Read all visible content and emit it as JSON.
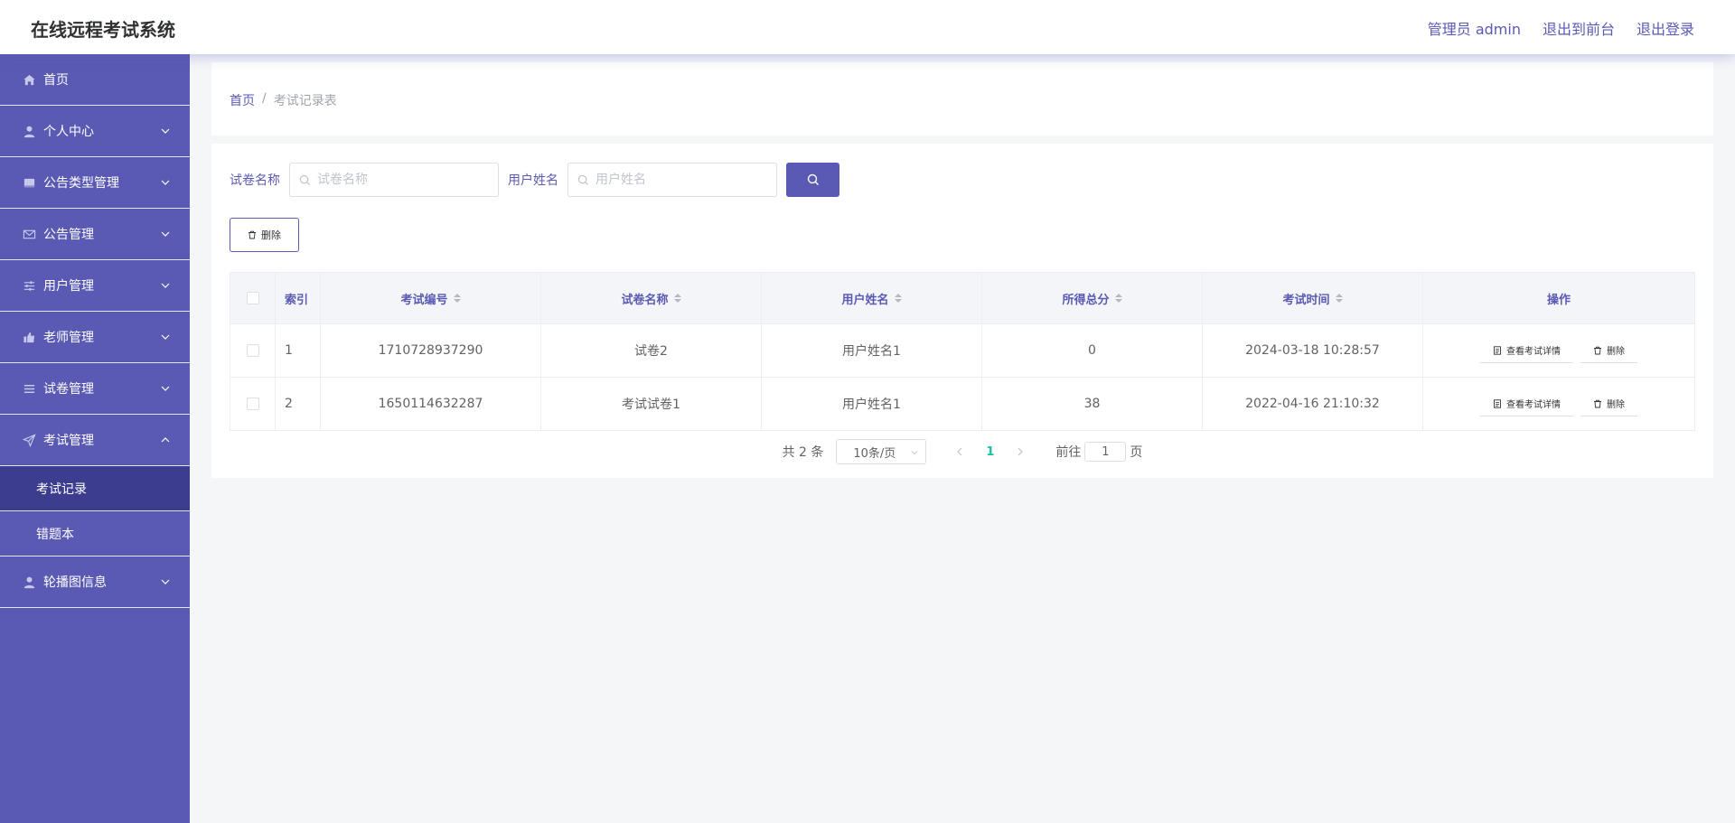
{
  "header": {
    "title": "在线远程考试系统",
    "user_label": "管理员 admin",
    "to_front_label": "退出到前台",
    "logout_label": "退出登录"
  },
  "sidebar": {
    "items": [
      {
        "label": "首页",
        "icon": "home-icon"
      },
      {
        "label": "个人中心",
        "icon": "user-icon"
      },
      {
        "label": "公告类型管理",
        "icon": "folder-icon"
      },
      {
        "label": "公告管理",
        "icon": "mail-icon"
      },
      {
        "label": "用户管理",
        "icon": "sliders-icon"
      },
      {
        "label": "老师管理",
        "icon": "thumbs-up-icon"
      },
      {
        "label": "试卷管理",
        "icon": "list-icon"
      },
      {
        "label": "考试管理",
        "icon": "send-icon"
      },
      {
        "label": "轮播图信息",
        "icon": "user-icon"
      }
    ],
    "submenu": [
      {
        "label": "考试记录",
        "active": true
      },
      {
        "label": "错题本",
        "active": false
      }
    ]
  },
  "breadcrumb": {
    "home": "首页",
    "separator": "/",
    "current": "考试记录表"
  },
  "search": {
    "paper_label": "试卷名称",
    "paper_placeholder": "试卷名称",
    "user_label": "用户姓名",
    "user_placeholder": "用户姓名"
  },
  "toolbar": {
    "delete_label": "删除"
  },
  "table": {
    "headers": [
      "索引",
      "考试编号",
      "试卷名称",
      "用户姓名",
      "所得总分",
      "考试时间",
      "操作"
    ],
    "rows": [
      {
        "index": "1",
        "exam_no": "1710728937290",
        "paper": "试卷2",
        "user": "用户姓名1",
        "score": "0",
        "time": "2024-03-18 10:28:57"
      },
      {
        "index": "2",
        "exam_no": "1650114632287",
        "paper": "考试试卷1",
        "user": "用户姓名1",
        "score": "38",
        "time": "2022-04-16 21:10:32"
      }
    ],
    "view_label": "查看考试详情",
    "delete_label": "删除"
  },
  "pagination": {
    "total_text": "共 2 条",
    "page_size": "10条/页",
    "current_page": "1",
    "goto_prefix": "前往",
    "goto_value": "1",
    "goto_suffix": "页"
  },
  "colors": {
    "primary": "#5a5ab4",
    "active_submenu": "#3d3d8f",
    "current_page": "#13c2a0"
  }
}
